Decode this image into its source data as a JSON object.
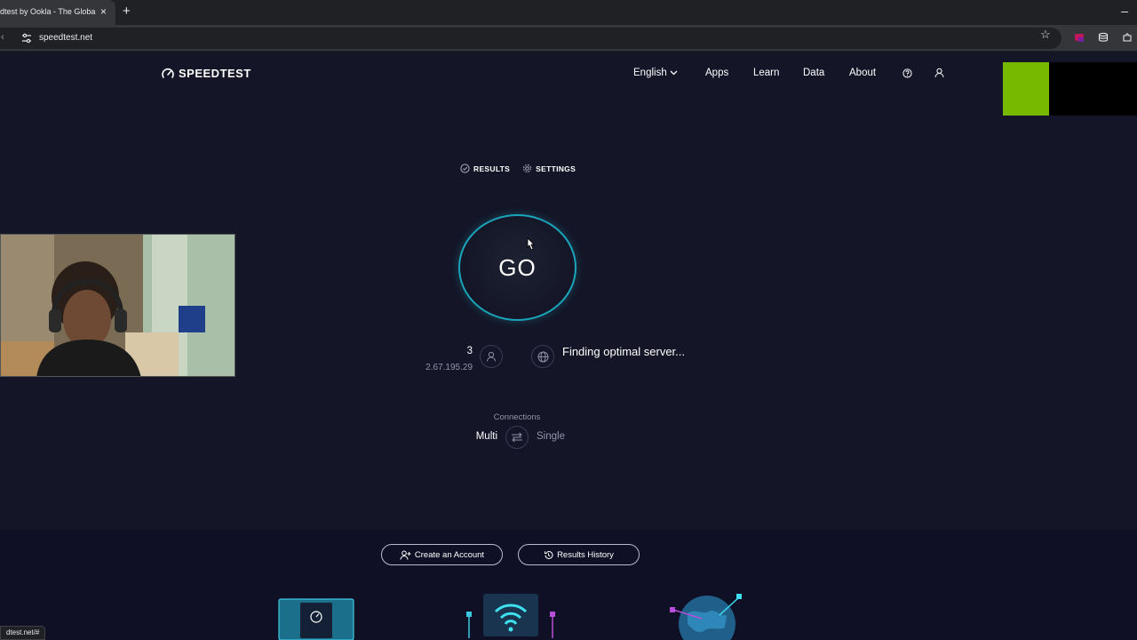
{
  "browser": {
    "tab_title": "dtest by Ookla - The Globa",
    "tab_close": "×",
    "new_tab": "+",
    "minimize": "–",
    "back": "‹",
    "url": "speedtest.net",
    "star": "☆",
    "status_url": "dtest.net/#"
  },
  "header": {
    "logo": "SPEEDTEST",
    "nav": {
      "language": "English",
      "apps": "Apps",
      "learn": "Learn",
      "data": "Data",
      "about": "About"
    }
  },
  "tabs": {
    "results": "RESULTS",
    "settings": "SETTINGS"
  },
  "test": {
    "go_label": "GO",
    "isp_number": "3",
    "ip": "2.67.195.29",
    "server_status": "Finding optimal server..."
  },
  "connections": {
    "label": "Connections",
    "multi": "Multi",
    "single": "Single"
  },
  "footer": {
    "create_account": "Create an Account",
    "results_history": "Results History"
  },
  "colors": {
    "page_bg": "#141526",
    "go_ring": "#1ba5ba",
    "overlay_green": "#76b900"
  }
}
